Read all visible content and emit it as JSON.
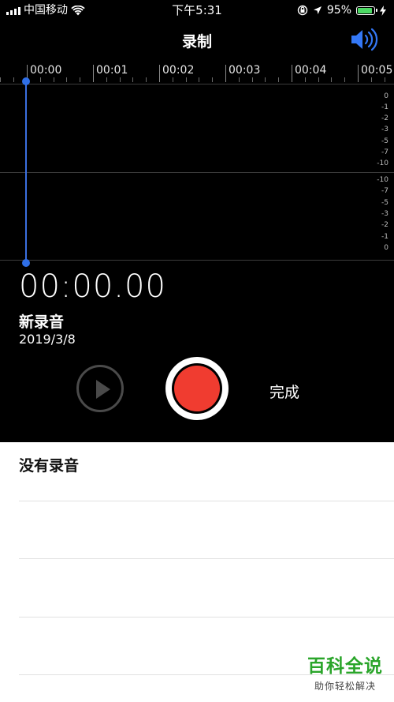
{
  "status_bar": {
    "carrier": "中国移动",
    "time": "下午5:31",
    "battery_percent": "95%",
    "battery_level": 0.95
  },
  "header": {
    "title": "录制",
    "speaker_icon": "speaker-volume-icon",
    "accent_color": "#3478f6"
  },
  "timeline": {
    "labels": [
      "00:00",
      "00:01",
      "00:02",
      "00:03",
      "00:04",
      "00:05"
    ]
  },
  "waveform": {
    "db_upper": [
      "0",
      "-1",
      "-2",
      "-3",
      "-5",
      "-7",
      "-10"
    ],
    "db_lower": [
      "-10",
      "-7",
      "-5",
      "-3",
      "-2",
      "-1",
      "0"
    ],
    "playhead_color": "#2f6fe8"
  },
  "recording": {
    "elapsed": "00:00.00",
    "name": "新录音",
    "date": "2019/3/8"
  },
  "controls": {
    "play_icon": "play-icon",
    "record_color": "#f03c30",
    "done_label": "完成"
  },
  "list": {
    "empty_label": "没有录音"
  },
  "watermark": {
    "main": "百科全说",
    "sub": "助你轻松解决"
  }
}
